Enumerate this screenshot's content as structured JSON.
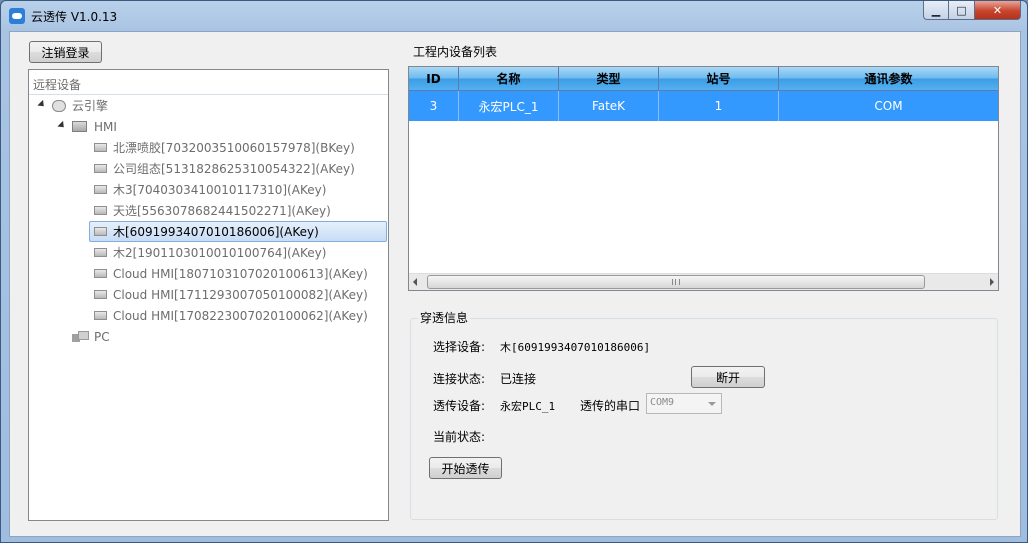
{
  "window": {
    "title": "云透传 V1.0.13"
  },
  "logout_label": "注销登录",
  "remote": {
    "header": "远程设备",
    "root": "云引擎",
    "hmi_group": "HMI",
    "devices": [
      "北漂喷胶[7032003510060157978](BKey)",
      "公司组态[5131828625310054322](AKey)",
      "木3[7040303410010117310](AKey)",
      "天选[5563078682441502271](AKey)",
      "木[6091993407010186006](AKey)",
      "木2[1901103010010100764](AKey)",
      "Cloud HMI[1807103107020100613](AKey)",
      "Cloud HMI[1711293007050100082](AKey)",
      "Cloud HMI[1708223007020100062](AKey)"
    ],
    "pc_group": "PC"
  },
  "device_list": {
    "title": "工程内设备列表",
    "columns": [
      "ID",
      "名称",
      "类型",
      "站号",
      "通讯参数"
    ],
    "rows": [
      {
        "id": "3",
        "name": "永宏PLC_1",
        "type": "FateK",
        "station": "1",
        "comm": "COM"
      }
    ],
    "scroll_grip": "III"
  },
  "passthrough": {
    "group_title": "穿透信息",
    "select_label": "选择设备:",
    "select_value": "木[6091993407010186006]",
    "conn_label": "连接状态:",
    "conn_value": "已连接",
    "disconnect_label": "断开",
    "trans_label": "透传设备:",
    "trans_value": "永宏PLC_1",
    "port_label": "透传的串口",
    "port_value": "COM9",
    "state_label": "当前状态:",
    "state_value": "",
    "start_label": "开始透传"
  }
}
